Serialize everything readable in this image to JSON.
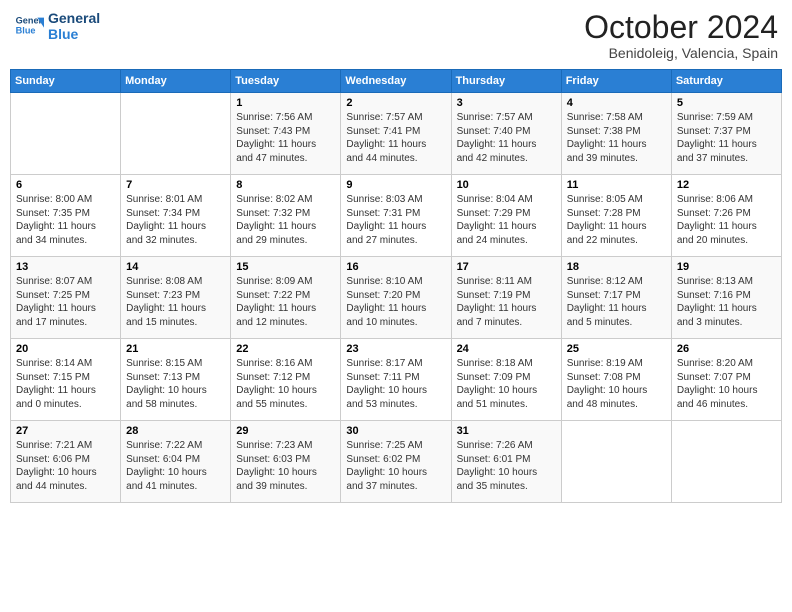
{
  "header": {
    "logo_line1": "General",
    "logo_line2": "Blue",
    "month": "October 2024",
    "location": "Benidoleig, Valencia, Spain"
  },
  "weekdays": [
    "Sunday",
    "Monday",
    "Tuesday",
    "Wednesday",
    "Thursday",
    "Friday",
    "Saturday"
  ],
  "weeks": [
    [
      {
        "day": "",
        "info": ""
      },
      {
        "day": "",
        "info": ""
      },
      {
        "day": "1",
        "info": "Sunrise: 7:56 AM\nSunset: 7:43 PM\nDaylight: 11 hours and 47 minutes."
      },
      {
        "day": "2",
        "info": "Sunrise: 7:57 AM\nSunset: 7:41 PM\nDaylight: 11 hours and 44 minutes."
      },
      {
        "day": "3",
        "info": "Sunrise: 7:57 AM\nSunset: 7:40 PM\nDaylight: 11 hours and 42 minutes."
      },
      {
        "day": "4",
        "info": "Sunrise: 7:58 AM\nSunset: 7:38 PM\nDaylight: 11 hours and 39 minutes."
      },
      {
        "day": "5",
        "info": "Sunrise: 7:59 AM\nSunset: 7:37 PM\nDaylight: 11 hours and 37 minutes."
      }
    ],
    [
      {
        "day": "6",
        "info": "Sunrise: 8:00 AM\nSunset: 7:35 PM\nDaylight: 11 hours and 34 minutes."
      },
      {
        "day": "7",
        "info": "Sunrise: 8:01 AM\nSunset: 7:34 PM\nDaylight: 11 hours and 32 minutes."
      },
      {
        "day": "8",
        "info": "Sunrise: 8:02 AM\nSunset: 7:32 PM\nDaylight: 11 hours and 29 minutes."
      },
      {
        "day": "9",
        "info": "Sunrise: 8:03 AM\nSunset: 7:31 PM\nDaylight: 11 hours and 27 minutes."
      },
      {
        "day": "10",
        "info": "Sunrise: 8:04 AM\nSunset: 7:29 PM\nDaylight: 11 hours and 24 minutes."
      },
      {
        "day": "11",
        "info": "Sunrise: 8:05 AM\nSunset: 7:28 PM\nDaylight: 11 hours and 22 minutes."
      },
      {
        "day": "12",
        "info": "Sunrise: 8:06 AM\nSunset: 7:26 PM\nDaylight: 11 hours and 20 minutes."
      }
    ],
    [
      {
        "day": "13",
        "info": "Sunrise: 8:07 AM\nSunset: 7:25 PM\nDaylight: 11 hours and 17 minutes."
      },
      {
        "day": "14",
        "info": "Sunrise: 8:08 AM\nSunset: 7:23 PM\nDaylight: 11 hours and 15 minutes."
      },
      {
        "day": "15",
        "info": "Sunrise: 8:09 AM\nSunset: 7:22 PM\nDaylight: 11 hours and 12 minutes."
      },
      {
        "day": "16",
        "info": "Sunrise: 8:10 AM\nSunset: 7:20 PM\nDaylight: 11 hours and 10 minutes."
      },
      {
        "day": "17",
        "info": "Sunrise: 8:11 AM\nSunset: 7:19 PM\nDaylight: 11 hours and 7 minutes."
      },
      {
        "day": "18",
        "info": "Sunrise: 8:12 AM\nSunset: 7:17 PM\nDaylight: 11 hours and 5 minutes."
      },
      {
        "day": "19",
        "info": "Sunrise: 8:13 AM\nSunset: 7:16 PM\nDaylight: 11 hours and 3 minutes."
      }
    ],
    [
      {
        "day": "20",
        "info": "Sunrise: 8:14 AM\nSunset: 7:15 PM\nDaylight: 11 hours and 0 minutes."
      },
      {
        "day": "21",
        "info": "Sunrise: 8:15 AM\nSunset: 7:13 PM\nDaylight: 10 hours and 58 minutes."
      },
      {
        "day": "22",
        "info": "Sunrise: 8:16 AM\nSunset: 7:12 PM\nDaylight: 10 hours and 55 minutes."
      },
      {
        "day": "23",
        "info": "Sunrise: 8:17 AM\nSunset: 7:11 PM\nDaylight: 10 hours and 53 minutes."
      },
      {
        "day": "24",
        "info": "Sunrise: 8:18 AM\nSunset: 7:09 PM\nDaylight: 10 hours and 51 minutes."
      },
      {
        "day": "25",
        "info": "Sunrise: 8:19 AM\nSunset: 7:08 PM\nDaylight: 10 hours and 48 minutes."
      },
      {
        "day": "26",
        "info": "Sunrise: 8:20 AM\nSunset: 7:07 PM\nDaylight: 10 hours and 46 minutes."
      }
    ],
    [
      {
        "day": "27",
        "info": "Sunrise: 7:21 AM\nSunset: 6:06 PM\nDaylight: 10 hours and 44 minutes."
      },
      {
        "day": "28",
        "info": "Sunrise: 7:22 AM\nSunset: 6:04 PM\nDaylight: 10 hours and 41 minutes."
      },
      {
        "day": "29",
        "info": "Sunrise: 7:23 AM\nSunset: 6:03 PM\nDaylight: 10 hours and 39 minutes."
      },
      {
        "day": "30",
        "info": "Sunrise: 7:25 AM\nSunset: 6:02 PM\nDaylight: 10 hours and 37 minutes."
      },
      {
        "day": "31",
        "info": "Sunrise: 7:26 AM\nSunset: 6:01 PM\nDaylight: 10 hours and 35 minutes."
      },
      {
        "day": "",
        "info": ""
      },
      {
        "day": "",
        "info": ""
      }
    ]
  ]
}
